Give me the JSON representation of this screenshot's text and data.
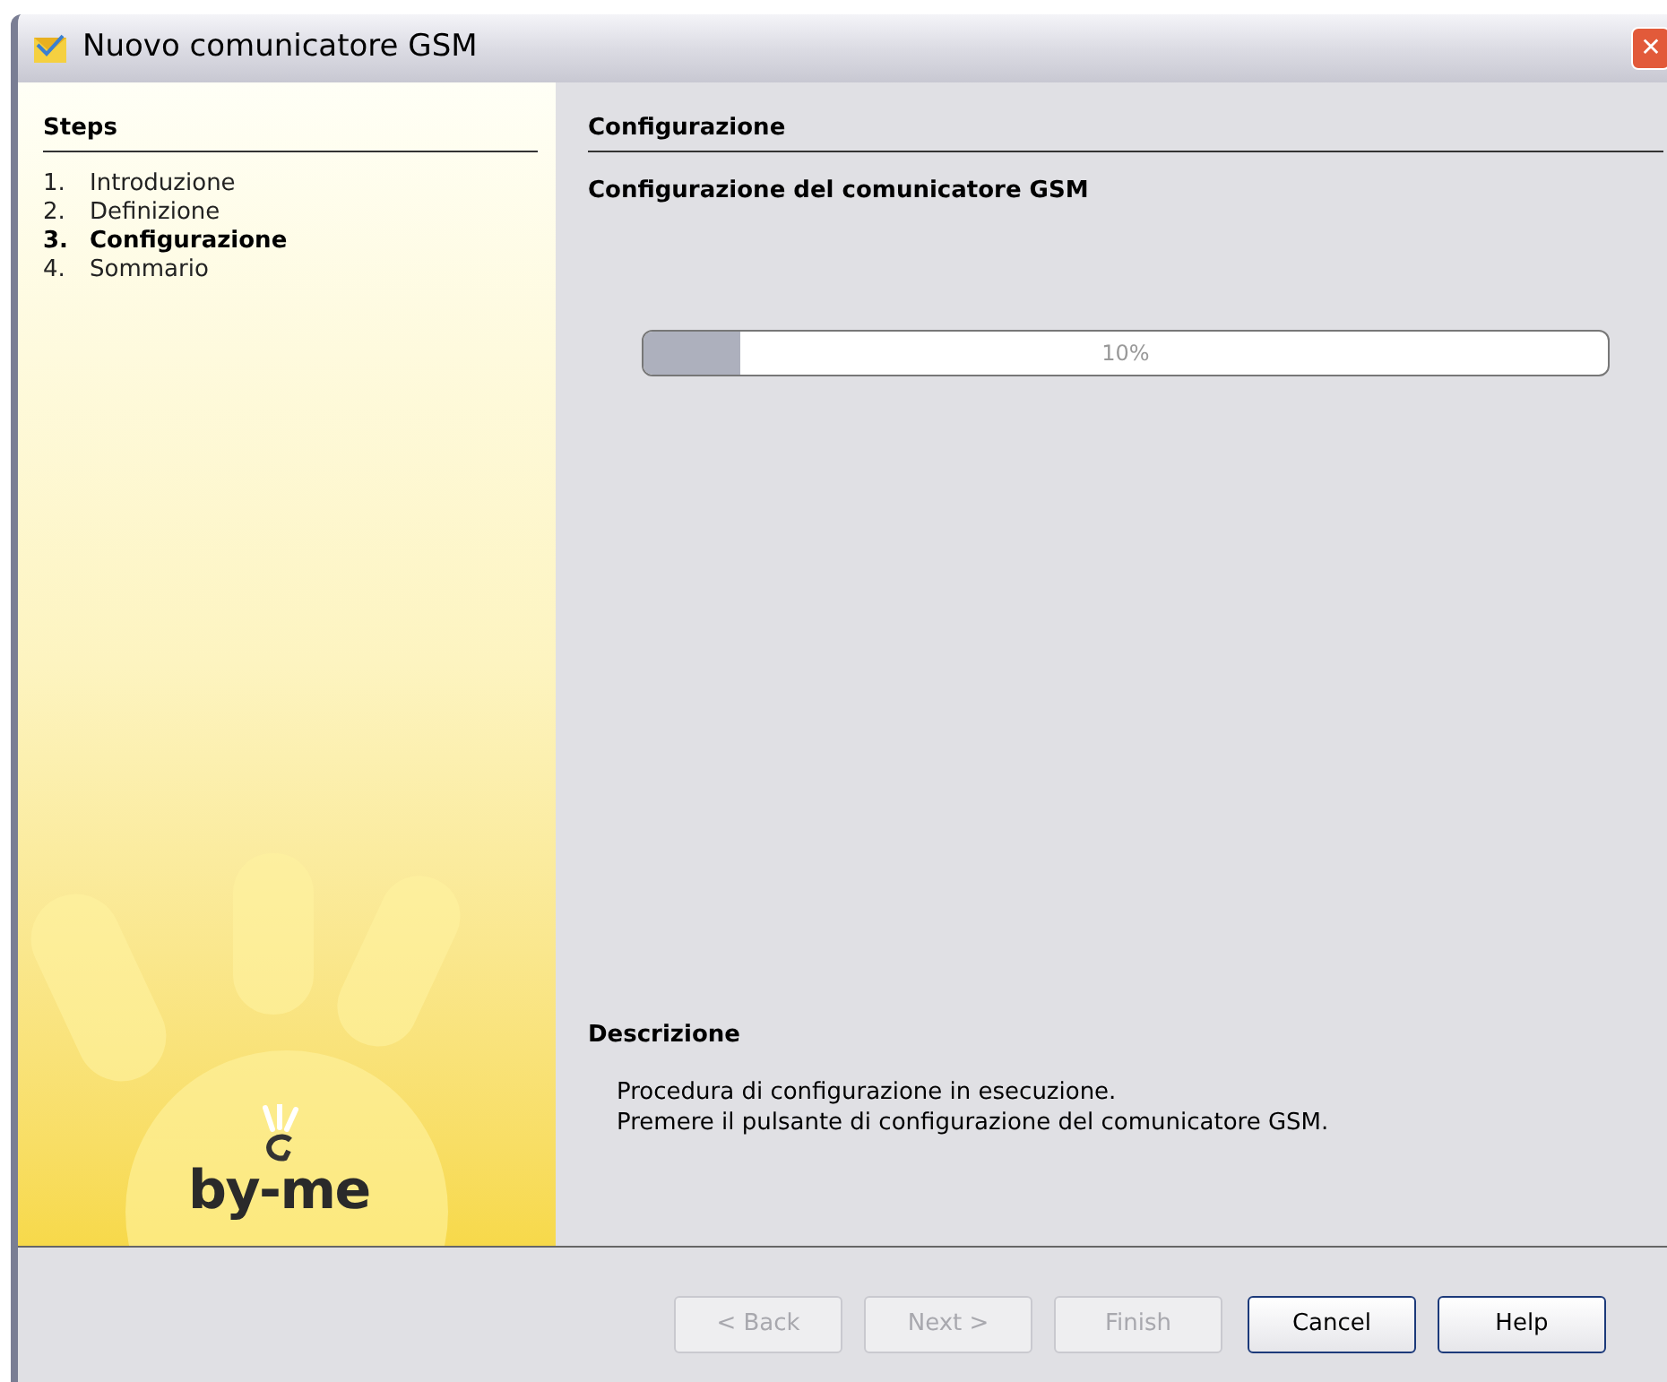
{
  "window": {
    "title": "Nuovo comunicatore GSM",
    "close": "✕"
  },
  "steps": {
    "title": "Steps",
    "items": [
      {
        "number": "1.",
        "label": "Introduzione",
        "selected": false
      },
      {
        "number": "2.",
        "label": "Definizione",
        "selected": false
      },
      {
        "number": "3.",
        "label": "Configurazione",
        "selected": true
      },
      {
        "number": "4.",
        "label": "Sommario",
        "selected": false
      }
    ],
    "logo_text": "by-me"
  },
  "content": {
    "title": "Configurazione",
    "heading": "Configurazione del comunicatore GSM",
    "progress": {
      "level": 0.1,
      "reading": "10%"
    },
    "description_title": "Descrizione",
    "description_lines": [
      "Procedura di configurazione in esecuzione.",
      "Premere il pulsante di configurazione del comunicatore GSM."
    ]
  },
  "buttons": [
    {
      "label": "< Back",
      "disabled": true,
      "kind": "back"
    },
    {
      "label": "Next >",
      "disabled": true,
      "kind": "next"
    },
    {
      "label": "Finish",
      "disabled": true,
      "kind": "finish"
    },
    {
      "label": "Cancel",
      "disabled": false,
      "kind": "cancel"
    },
    {
      "label": "Help",
      "disabled": false,
      "kind": "help"
    }
  ]
}
